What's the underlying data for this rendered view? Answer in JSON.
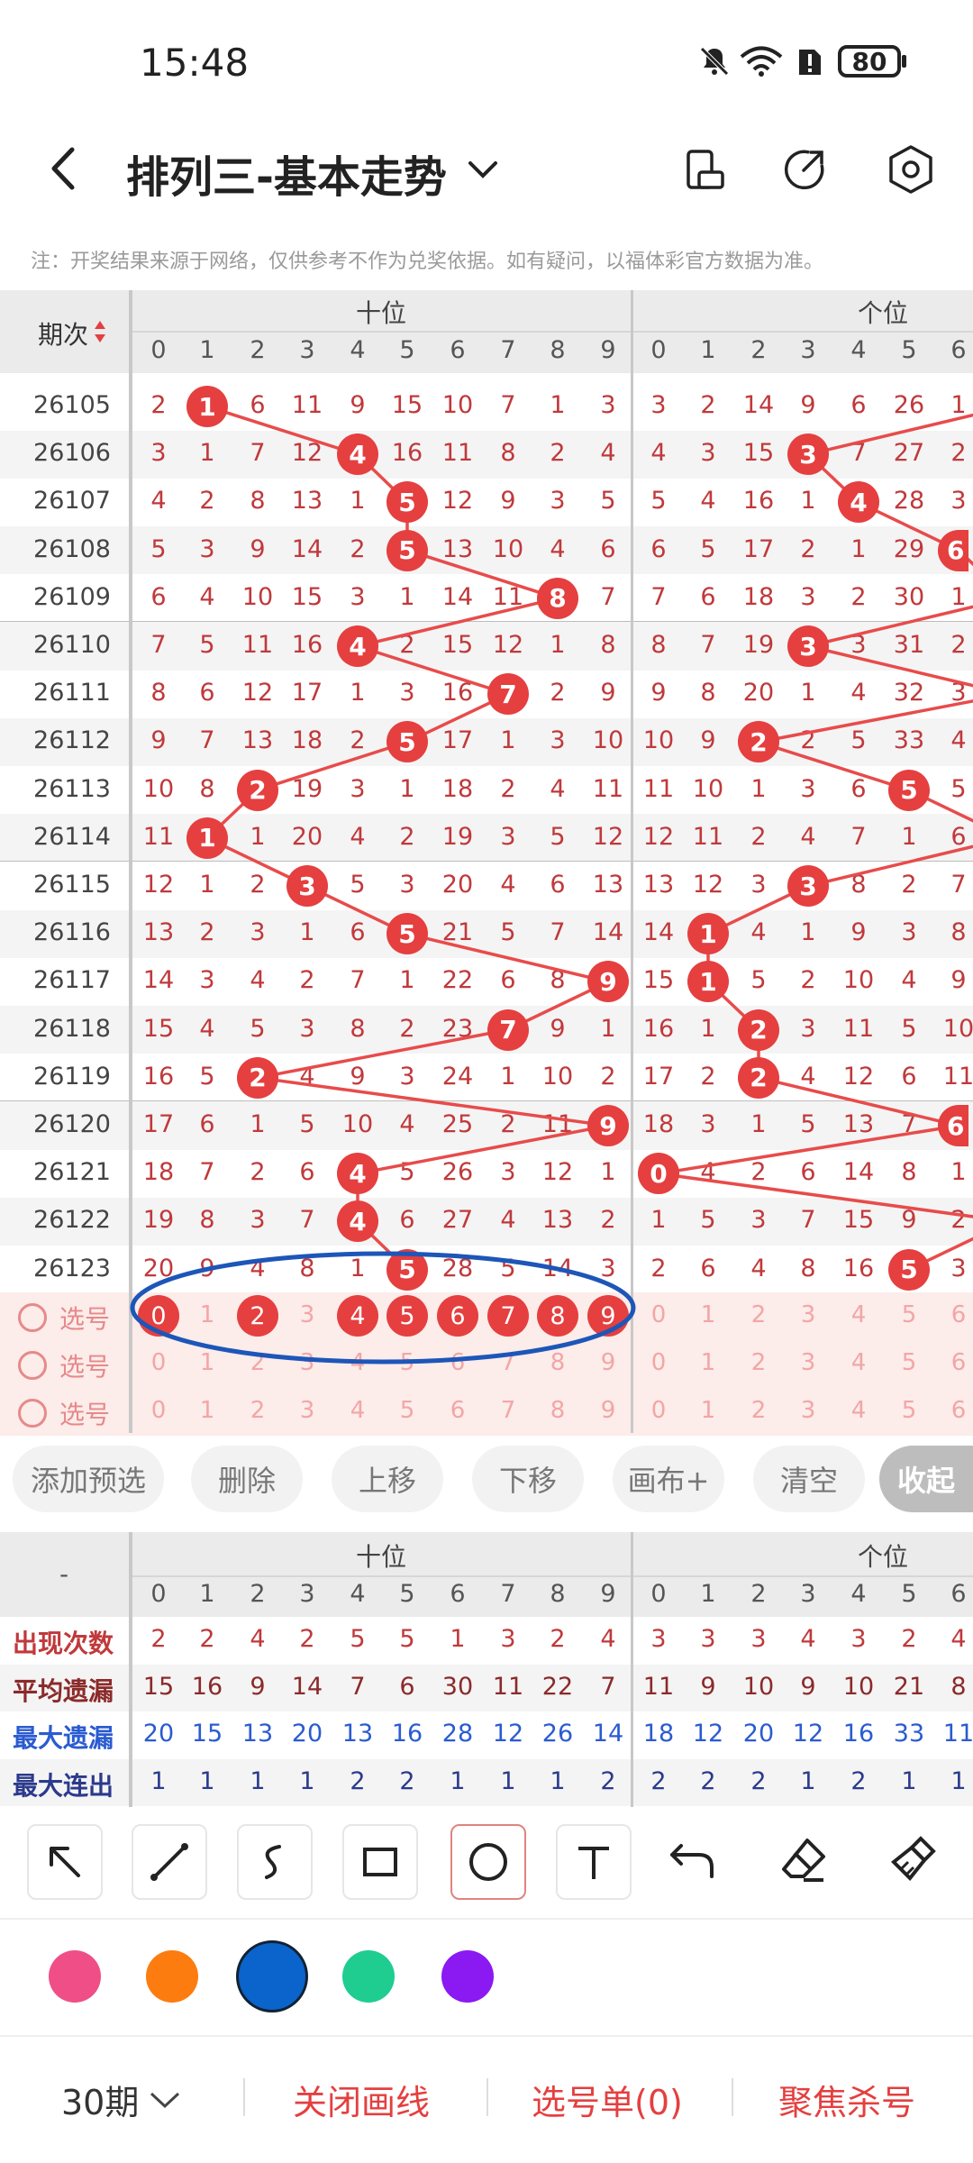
{
  "status_bar": {
    "time": "15:48",
    "battery": "80"
  },
  "header": {
    "title": "排列三-基本走势"
  },
  "notice": "注：开奖结果来源于网络，仅供参考不作为兑奖依据。如有疑问，以福体彩官方数据为准。",
  "table": {
    "period_header": "期次",
    "group_tens": "十位",
    "group_units": "个位",
    "digits": [
      "0",
      "1",
      "2",
      "3",
      "4",
      "5",
      "6",
      "7",
      "8",
      "9"
    ],
    "units_digits": [
      "0",
      "1",
      "2",
      "3",
      "4",
      "5",
      "6"
    ],
    "rows": [
      {
        "period": "26105",
        "tens": [
          "2",
          "1",
          "6",
          "11",
          "9",
          "15",
          "10",
          "7",
          "1",
          "3"
        ],
        "units": [
          "3",
          "2",
          "14",
          "9",
          "6",
          "26",
          "1"
        ]
      },
      {
        "period": "26106",
        "tens": [
          "3",
          "1",
          "7",
          "12",
          "4",
          "16",
          "11",
          "8",
          "2",
          "4"
        ],
        "units": [
          "4",
          "3",
          "15",
          "3",
          "7",
          "27",
          "2"
        ]
      },
      {
        "period": "26107",
        "tens": [
          "4",
          "2",
          "8",
          "13",
          "1",
          "5",
          "12",
          "9",
          "3",
          "5"
        ],
        "units": [
          "5",
          "4",
          "16",
          "1",
          "4",
          "28",
          "3"
        ]
      },
      {
        "period": "26108",
        "tens": [
          "5",
          "3",
          "9",
          "14",
          "2",
          "5",
          "13",
          "10",
          "4",
          "6"
        ],
        "units": [
          "6",
          "5",
          "17",
          "2",
          "1",
          "29",
          "6"
        ]
      },
      {
        "period": "26109",
        "tens": [
          "6",
          "4",
          "10",
          "15",
          "3",
          "1",
          "14",
          "11",
          "8",
          "7"
        ],
        "units": [
          "7",
          "6",
          "18",
          "3",
          "2",
          "30",
          "1"
        ]
      },
      {
        "period": "26110",
        "tens": [
          "7",
          "5",
          "11",
          "16",
          "4",
          "2",
          "15",
          "12",
          "1",
          "8"
        ],
        "units": [
          "8",
          "7",
          "19",
          "3",
          "3",
          "31",
          "2"
        ]
      },
      {
        "period": "26111",
        "tens": [
          "8",
          "6",
          "12",
          "17",
          "1",
          "3",
          "16",
          "7",
          "2",
          "9"
        ],
        "units": [
          "9",
          "8",
          "20",
          "1",
          "4",
          "32",
          "3"
        ]
      },
      {
        "period": "26112",
        "tens": [
          "9",
          "7",
          "13",
          "18",
          "2",
          "5",
          "17",
          "1",
          "3",
          "10"
        ],
        "units": [
          "10",
          "9",
          "2",
          "2",
          "5",
          "33",
          "4"
        ]
      },
      {
        "period": "26113",
        "tens": [
          "10",
          "8",
          "2",
          "19",
          "3",
          "1",
          "18",
          "2",
          "4",
          "11"
        ],
        "units": [
          "11",
          "10",
          "1",
          "3",
          "6",
          "5",
          "5"
        ]
      },
      {
        "period": "26114",
        "tens": [
          "11",
          "1",
          "1",
          "20",
          "4",
          "2",
          "19",
          "3",
          "5",
          "12"
        ],
        "units": [
          "12",
          "11",
          "2",
          "4",
          "7",
          "1",
          "6"
        ]
      },
      {
        "period": "26115",
        "tens": [
          "12",
          "1",
          "2",
          "3",
          "5",
          "3",
          "20",
          "4",
          "6",
          "13"
        ],
        "units": [
          "13",
          "12",
          "3",
          "3",
          "8",
          "2",
          "7"
        ]
      },
      {
        "period": "26116",
        "tens": [
          "13",
          "2",
          "3",
          "1",
          "6",
          "5",
          "21",
          "5",
          "7",
          "14"
        ],
        "units": [
          "14",
          "1",
          "4",
          "1",
          "9",
          "3",
          "8"
        ]
      },
      {
        "period": "26117",
        "tens": [
          "14",
          "3",
          "4",
          "2",
          "7",
          "1",
          "22",
          "6",
          "8",
          "9"
        ],
        "units": [
          "15",
          "1",
          "5",
          "2",
          "10",
          "4",
          "9"
        ]
      },
      {
        "period": "26118",
        "tens": [
          "15",
          "4",
          "5",
          "3",
          "8",
          "2",
          "23",
          "7",
          "9",
          "1"
        ],
        "units": [
          "16",
          "1",
          "2",
          "3",
          "11",
          "5",
          "10"
        ]
      },
      {
        "period": "26119",
        "tens": [
          "16",
          "5",
          "2",
          "4",
          "9",
          "3",
          "24",
          "1",
          "10",
          "2"
        ],
        "units": [
          "17",
          "2",
          "2",
          "4",
          "12",
          "6",
          "11"
        ]
      },
      {
        "period": "26120",
        "tens": [
          "17",
          "6",
          "1",
          "5",
          "10",
          "4",
          "25",
          "2",
          "11",
          "9"
        ],
        "units": [
          "18",
          "3",
          "1",
          "5",
          "13",
          "7",
          "6"
        ]
      },
      {
        "period": "26121",
        "tens": [
          "18",
          "7",
          "2",
          "6",
          "4",
          "5",
          "26",
          "3",
          "12",
          "1"
        ],
        "units": [
          "0",
          "4",
          "2",
          "6",
          "14",
          "8",
          "1"
        ]
      },
      {
        "period": "26122",
        "tens": [
          "19",
          "8",
          "3",
          "7",
          "4",
          "6",
          "27",
          "4",
          "13",
          "2"
        ],
        "units": [
          "1",
          "5",
          "3",
          "7",
          "15",
          "9",
          "2"
        ]
      },
      {
        "period": "26123",
        "tens": [
          "20",
          "9",
          "4",
          "8",
          "1",
          "5",
          "28",
          "5",
          "14",
          "3"
        ],
        "units": [
          "2",
          "6",
          "4",
          "8",
          "16",
          "5",
          "3"
        ]
      }
    ],
    "tens_hits": [
      1,
      4,
      5,
      5,
      8,
      4,
      7,
      5,
      2,
      1,
      3,
      5,
      9,
      7,
      2,
      9,
      4,
      4,
      5
    ],
    "units_hits": [
      7,
      3,
      4,
      6,
      7,
      3,
      7,
      2,
      5,
      7,
      3,
      1,
      1,
      2,
      2,
      6,
      0,
      7,
      5
    ],
    "select_label": "选号",
    "select_rows": [
      {
        "tens_selected": [
          0,
          2,
          4,
          5,
          6,
          7,
          8,
          9
        ]
      },
      {
        "tens_selected": []
      },
      {
        "tens_selected": []
      }
    ]
  },
  "actions": [
    "添加预选",
    "删除",
    "上移",
    "下移",
    "画布+",
    "清空",
    "收起"
  ],
  "stats": {
    "header_dash": "-",
    "rows": [
      {
        "label": "出现次数",
        "color": "#c0393b",
        "tens": [
          "2",
          "2",
          "4",
          "2",
          "5",
          "5",
          "1",
          "3",
          "2",
          "4"
        ],
        "units": [
          "3",
          "3",
          "3",
          "4",
          "3",
          "2",
          "4"
        ]
      },
      {
        "label": "平均遗漏",
        "color": "#8b2a2a",
        "tens": [
          "15",
          "16",
          "9",
          "14",
          "7",
          "6",
          "30",
          "11",
          "22",
          "7"
        ],
        "units": [
          "11",
          "9",
          "10",
          "9",
          "10",
          "21",
          "8"
        ]
      },
      {
        "label": "最大遗漏",
        "color": "#2a5bd0",
        "tens": [
          "20",
          "15",
          "13",
          "20",
          "13",
          "16",
          "28",
          "12",
          "26",
          "14"
        ],
        "units": [
          "18",
          "12",
          "20",
          "12",
          "16",
          "33",
          "11"
        ]
      },
      {
        "label": "最大连出",
        "color": "#2b3a8c",
        "tens": [
          "1",
          "1",
          "1",
          "1",
          "2",
          "2",
          "1",
          "1",
          "1",
          "2"
        ],
        "units": [
          "2",
          "2",
          "2",
          "1",
          "2",
          "1",
          "1"
        ]
      }
    ]
  },
  "tools": [
    "arrow-tool",
    "line-tool",
    "curve-tool",
    "rectangle-tool",
    "circle-tool",
    "text-tool",
    "undo-tool",
    "eraser-tool",
    "clear-tool"
  ],
  "colors": [
    "#ef4f86",
    "#fd7c10",
    "#0b63cc",
    "#1fcd91",
    "#8b19f2"
  ],
  "bottom_bar": {
    "periods": "30期",
    "close_draw": "关闭画线",
    "ticket": "选号单(0)",
    "focus": "聚焦杀号"
  }
}
